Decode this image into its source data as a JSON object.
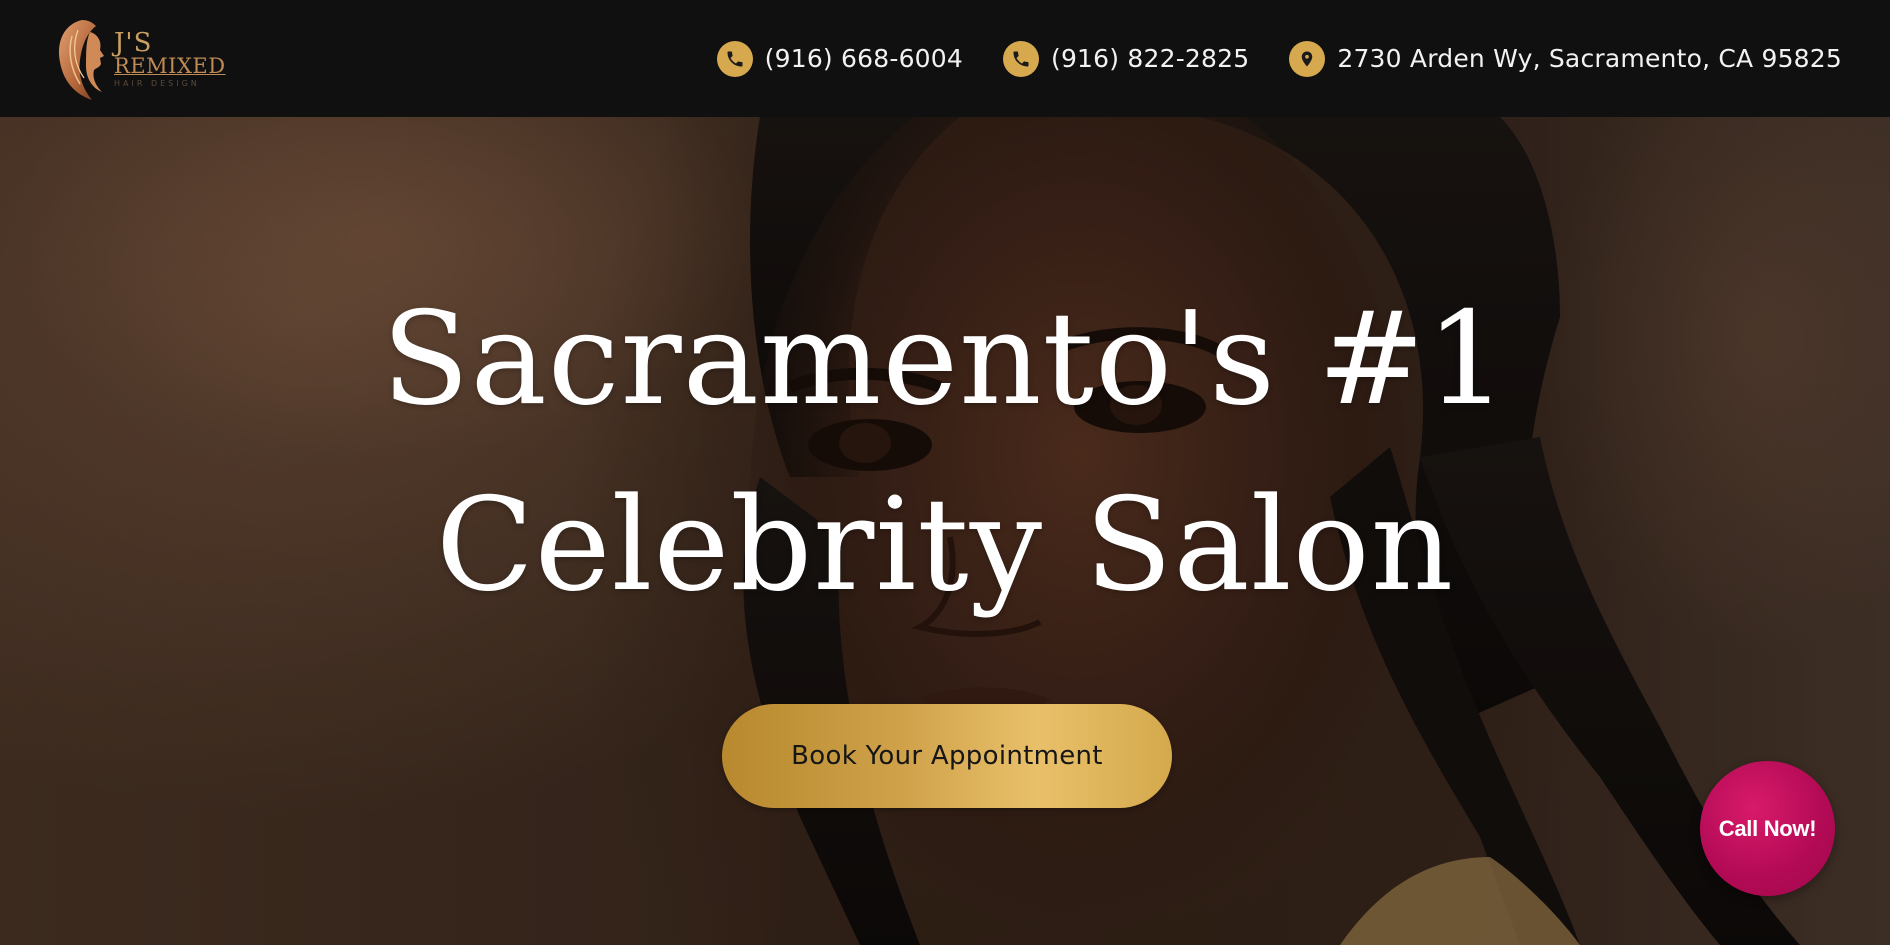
{
  "brand": {
    "logo_line1": "J'S",
    "logo_line2": "REMIXED",
    "logo_line3": "HAIR DESIGN"
  },
  "header": {
    "contacts": [
      {
        "icon": "phone-icon",
        "text": "(916) 668-6004"
      },
      {
        "icon": "phone-icon",
        "text": "(916) 822-2825"
      },
      {
        "icon": "location-pin-icon",
        "text": "2730 Arden Wy, Sacramento, CA 95825"
      }
    ]
  },
  "hero": {
    "headline_line1": "Sacramento's #1",
    "headline_line2": "Celebrity Salon",
    "cta_label": "Book Your Appointment"
  },
  "floating": {
    "call_label": "Call Now!"
  },
  "colors": {
    "header_bg": "#101010",
    "accent_gold": "#d6a94f",
    "call_magenta": "#b20a55",
    "headline_text": "#ffffff"
  }
}
